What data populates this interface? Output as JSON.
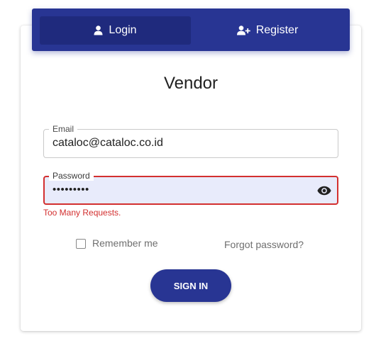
{
  "tabs": {
    "login": {
      "label": "Login",
      "icon": "user-icon",
      "active": true
    },
    "register": {
      "label": "Register",
      "icon": "user-plus-icon",
      "active": false
    }
  },
  "form": {
    "title": "Vendor",
    "email": {
      "label": "Email",
      "value": "cataloc@cataloc.co.id"
    },
    "password": {
      "label": "Password",
      "value": "•••••••••",
      "visibility_icon": "eye-icon",
      "error": "Too Many Requests."
    },
    "remember_label": "Remember me",
    "forgot_label": "Forgot password?",
    "submit_label": "SIGN IN"
  },
  "colors": {
    "primary": "#283593",
    "error": "#d32f2f",
    "autofill": "#e8ebfb"
  }
}
